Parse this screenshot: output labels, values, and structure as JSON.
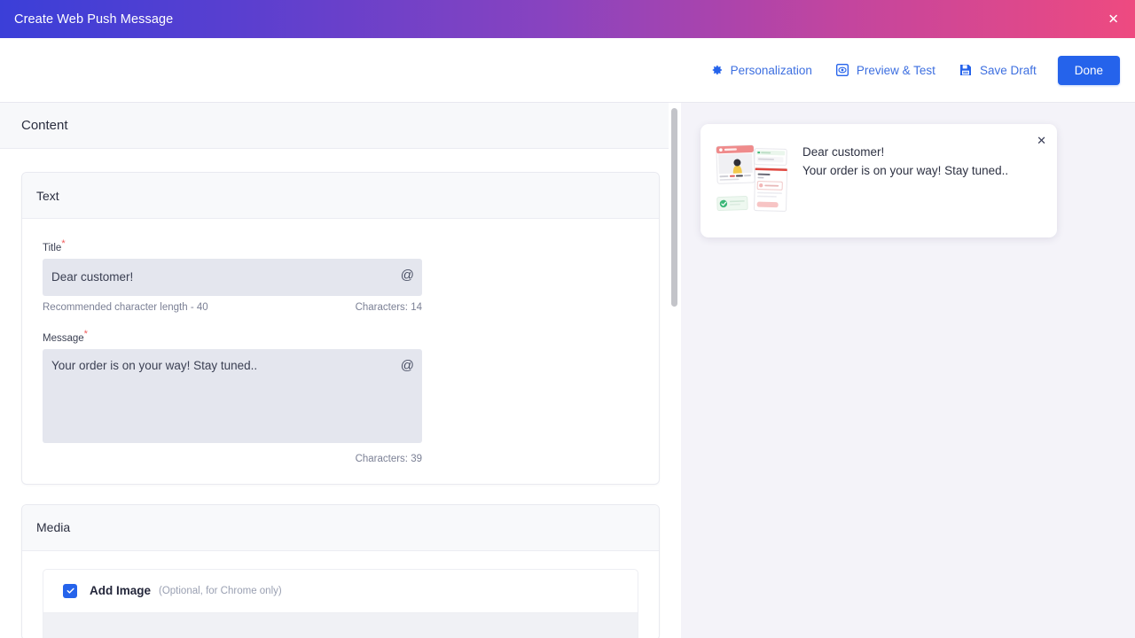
{
  "titlebar": {
    "title": "Create Web Push Message",
    "close_label": "✕"
  },
  "toolbar": {
    "personalization_label": "Personalization",
    "preview_test_label": "Preview & Test",
    "save_draft_label": "Save Draft",
    "done_label": "Done",
    "accent_color": "#2563eb",
    "link_color": "#3d6fe0"
  },
  "content": {
    "header_title": "Content",
    "text_card": {
      "card_title": "Text",
      "title_label": "Title",
      "title_required_mark": "*",
      "title_value": "Dear customer!",
      "title_hint": "Recommended character length - 40",
      "title_characters": "Characters: 14",
      "message_label": "Message",
      "message_required_mark": "*",
      "message_value": "Your order is on your way! Stay tuned..",
      "message_characters": "Characters: 39",
      "personalization_icon": "@"
    },
    "media_card": {
      "card_title": "Media",
      "add_image_label": "Add Image",
      "add_image_note": "(Optional, for Chrome only)",
      "add_image_checked": true
    }
  },
  "preview": {
    "notification_title": "Dear customer!",
    "notification_body": "Your order is on your way! Stay tuned..",
    "close_label": "✕",
    "panel_background": "#f4f3f9"
  }
}
